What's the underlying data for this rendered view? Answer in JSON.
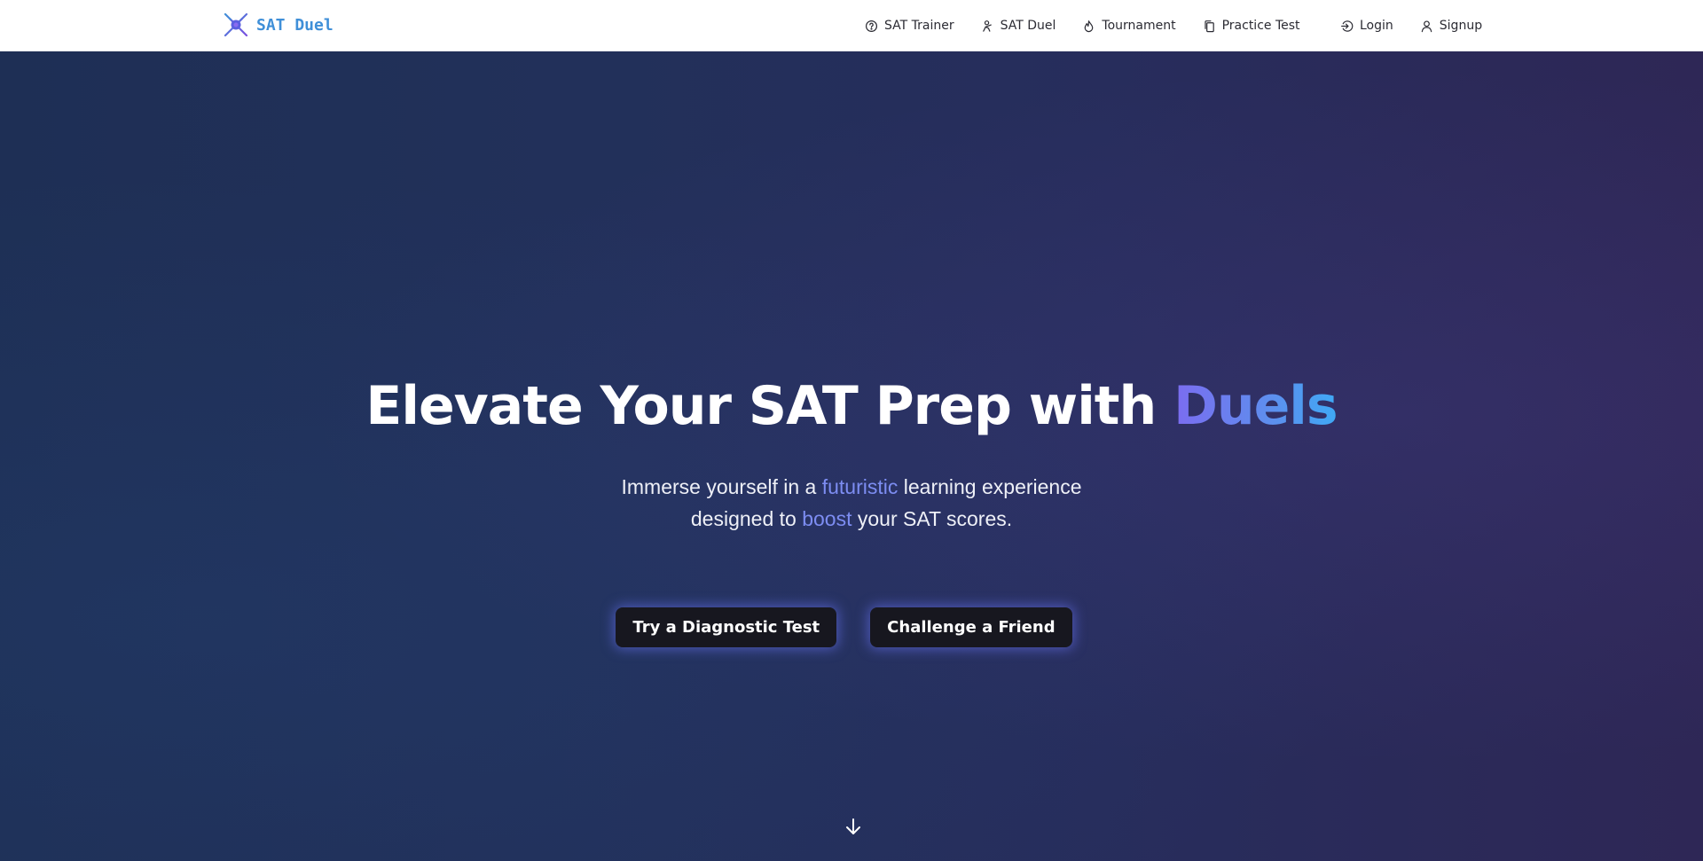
{
  "brand": {
    "name": "SAT Duel",
    "icon": "spider-logo-icon"
  },
  "nav": {
    "links": [
      {
        "label": "SAT Trainer",
        "icon": "question-circle-icon"
      },
      {
        "label": "SAT Duel",
        "icon": "duel-icon"
      },
      {
        "label": "Tournament",
        "icon": "flame-icon"
      },
      {
        "label": "Practice Test",
        "icon": "document-copy-icon"
      }
    ],
    "auth": [
      {
        "label": "Login",
        "icon": "login-icon"
      },
      {
        "label": "Signup",
        "icon": "user-icon"
      }
    ]
  },
  "hero": {
    "title_prefix": "Elevate Your SAT Prep with ",
    "title_highlight": "Duels",
    "subtitle": {
      "line1_a": "Immerse yourself in a ",
      "line1_hl": "futuristic",
      "line1_b": " learning experience",
      "line2_a": "designed to ",
      "line2_hl": "boost",
      "line2_b": " your SAT scores."
    },
    "buttons": {
      "primary": "Try a Diagnostic Test",
      "secondary": "Challenge a Friend"
    },
    "scroll_icon": "arrow-down-icon"
  },
  "colors": {
    "brand": "#3f8fd8",
    "hero_bg_left": "#1e2f55",
    "hero_bg_right": "#2e2756",
    "accent_purple": "#7b6cf0",
    "accent_blue": "#3fa9f5",
    "button_bg": "#17171f"
  }
}
